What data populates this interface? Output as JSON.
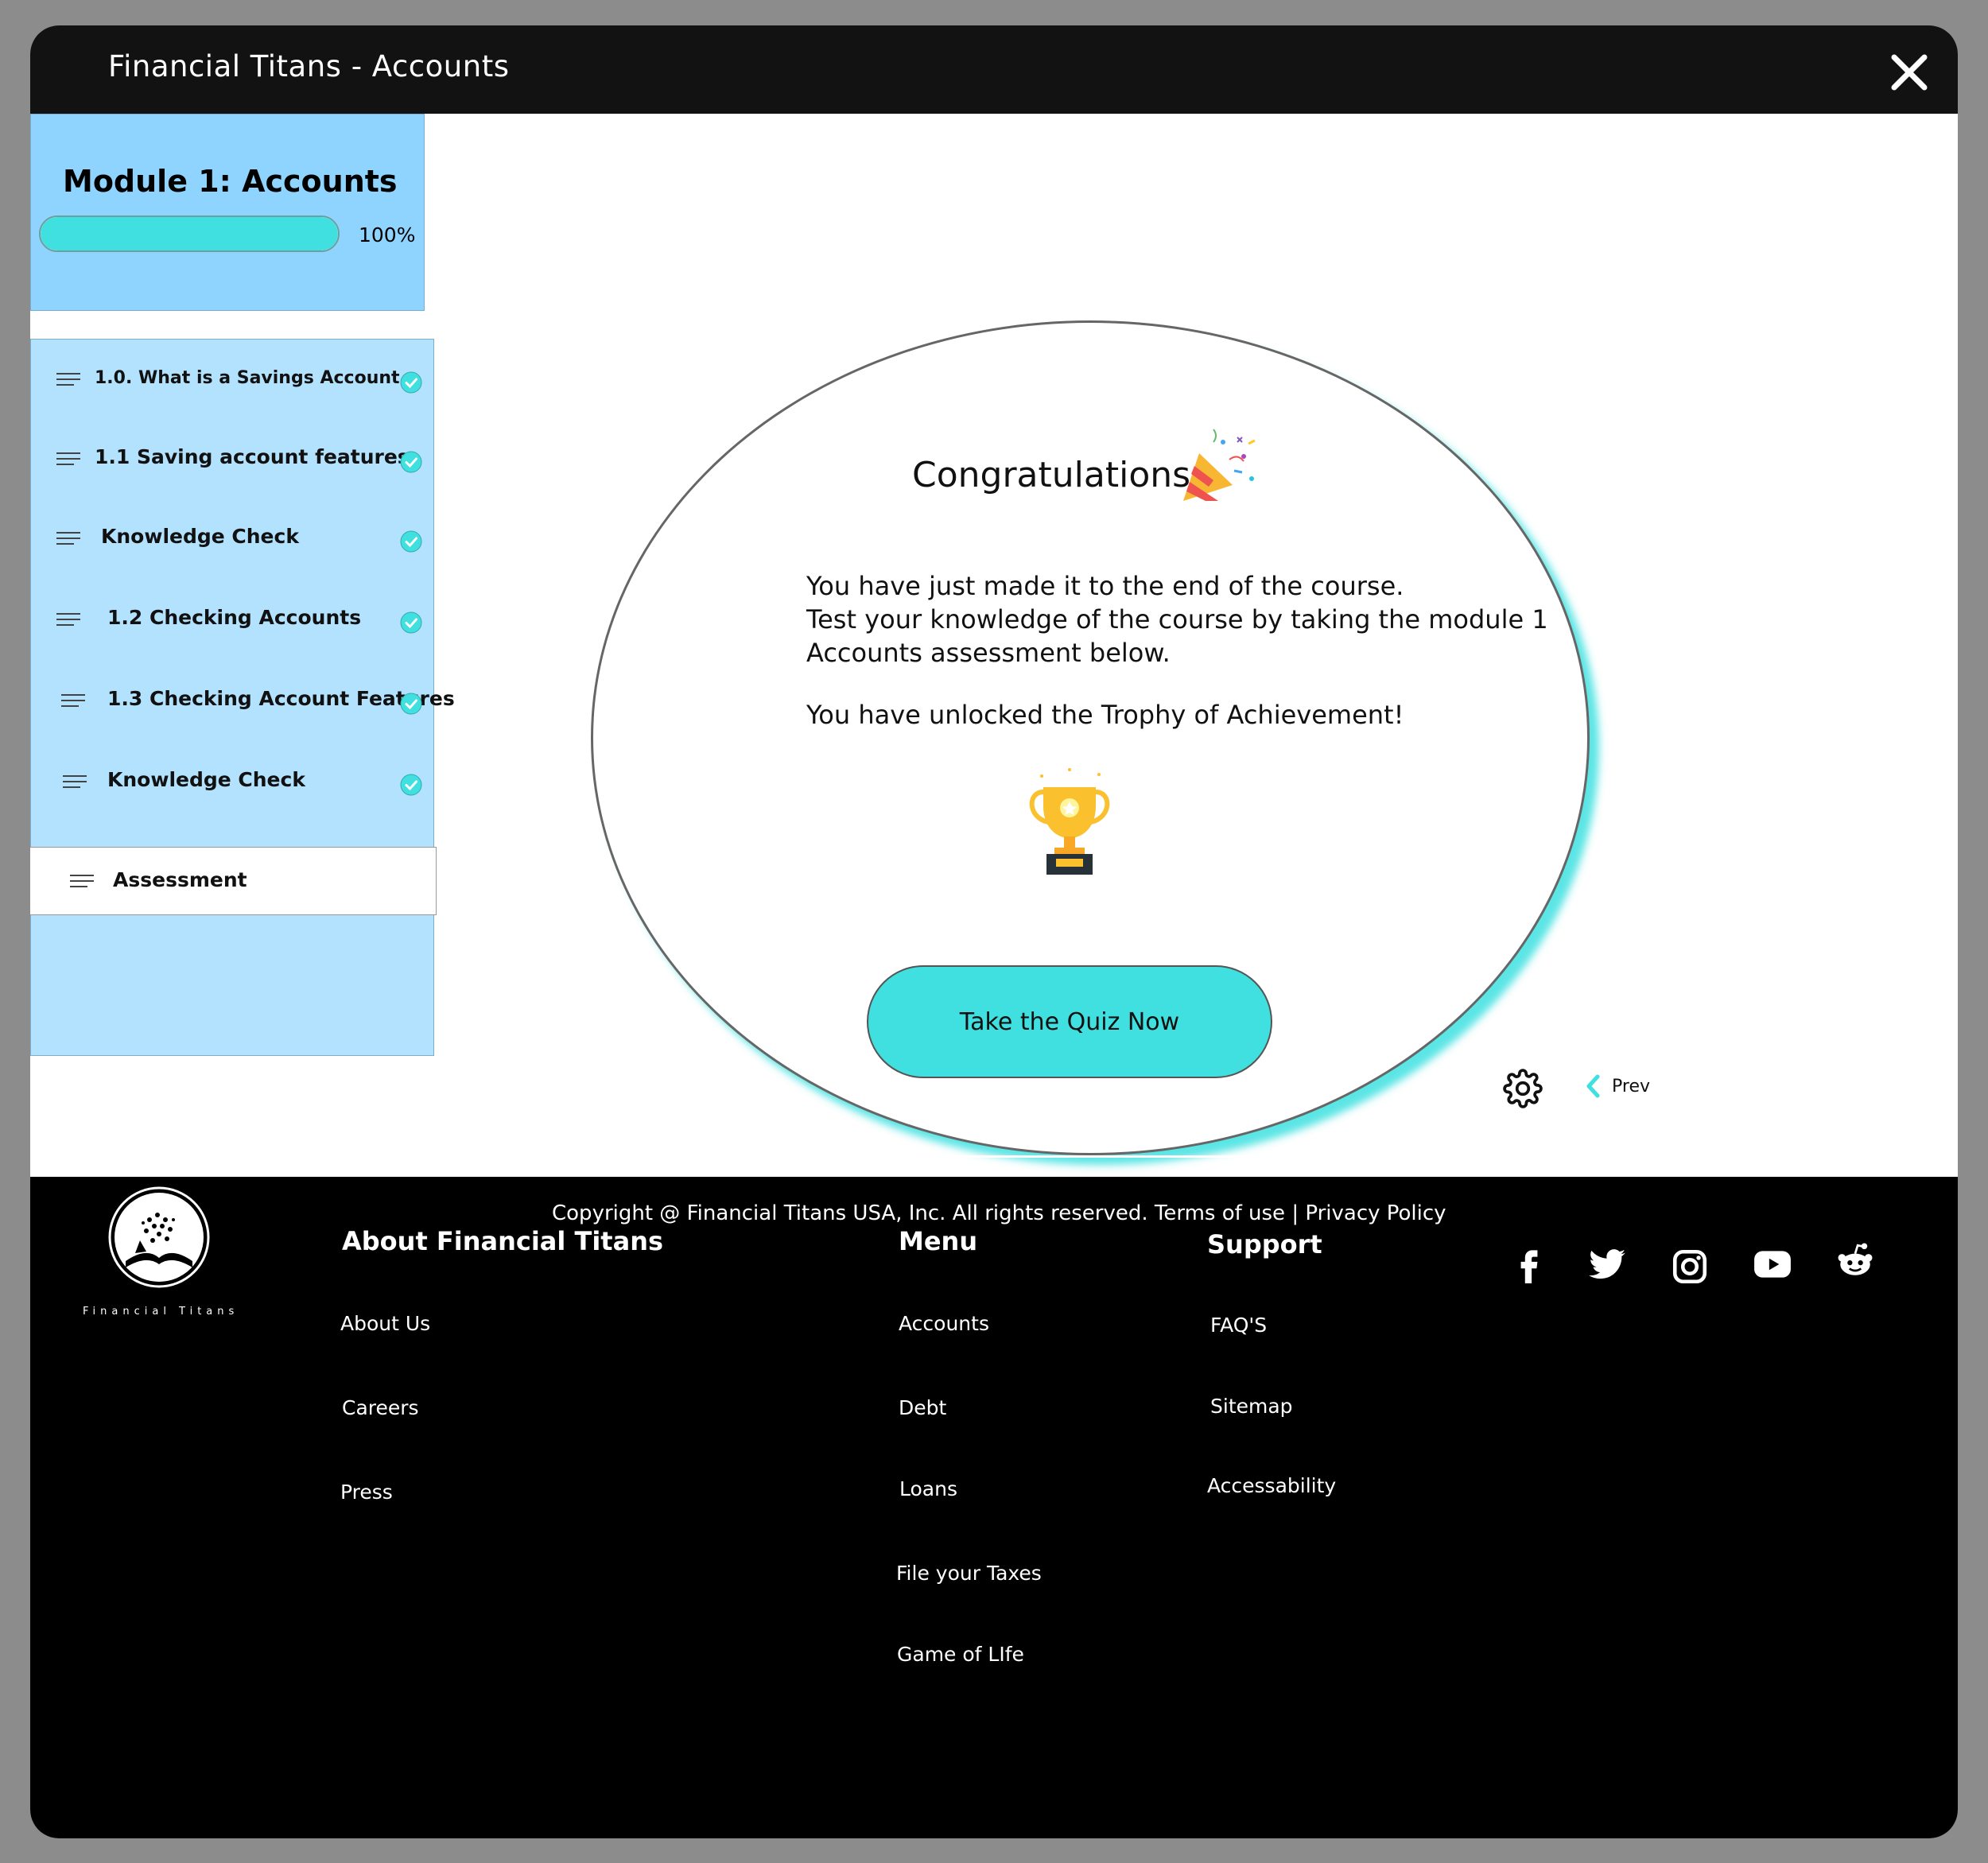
{
  "window": {
    "title": "Financial Titans - Accounts"
  },
  "module": {
    "title": "Module 1: Accounts",
    "progress": 1.0,
    "progress_label": "100%"
  },
  "lessons": [
    {
      "label": "1.0. What is a Savings Account",
      "completed": true
    },
    {
      "label": "1.1 Saving account features",
      "completed": true
    },
    {
      "label": "Knowledge Check",
      "completed": true
    },
    {
      "label": "1.2 Checking Accounts",
      "completed": true
    },
    {
      "label": "1.3 Checking Account Features",
      "completed": true
    },
    {
      "label": "Knowledge Check",
      "completed": true
    },
    {
      "label": "Assessment",
      "completed": false,
      "active": true
    }
  ],
  "main": {
    "heading": "Congratulations",
    "message_line1": "You have just made it to the end of the course.",
    "message_line2": "Test your knowledge of the course by taking the module 1",
    "message_line3": "Accounts assessment below.",
    "unlock_message": "You have unlocked the Trophy of Achievement!",
    "quiz_button": "Take the Quiz Now",
    "prev_label": "Prev"
  },
  "footer": {
    "logo_text": "Financial Titans",
    "about": {
      "heading": "About Financial Titans",
      "links": [
        "About Us",
        "Careers",
        "Press"
      ]
    },
    "menu": {
      "heading": "Menu",
      "links": [
        "Accounts",
        "Debt",
        "Loans",
        "File your Taxes",
        "Game of LIfe"
      ]
    },
    "support": {
      "heading": "Support",
      "links": [
        "FAQ'S",
        "Sitemap",
        "Accessability"
      ]
    },
    "social": [
      "facebook-icon",
      "twitter-icon",
      "instagram-icon",
      "youtube-icon",
      "reddit-icon"
    ],
    "copyright": "Copyright @ Financial Titans USA, Inc. All rights reserved.",
    "terms": "Terms of use",
    "separator": "|",
    "privacy": "Privacy Policy"
  },
  "colors": {
    "accent": "#40e0e0",
    "module_card": "#8fd4ff",
    "lesson_panel": "#b3e2ff",
    "titlebar": "#121212",
    "footer": "#000000"
  }
}
